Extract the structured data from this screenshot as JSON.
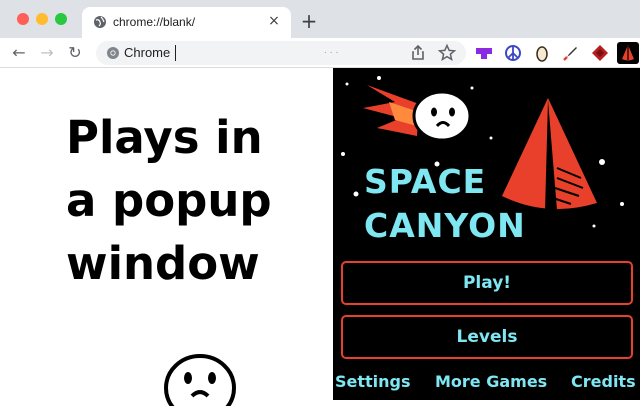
{
  "browser": {
    "tab_title": "chrome://blank/",
    "tab_close": "×",
    "new_tab": "+",
    "back": "←",
    "forward": "→",
    "reload": "↻",
    "omnibox_text": "Chrome",
    "omnibox_hint": ". . .",
    "extensions": [
      "purple-puzzle-extension",
      "peace-sign-extension",
      "egg-extension",
      "rocket-extension",
      "red-gem-extension",
      "canyon-cone-extension"
    ]
  },
  "promo": {
    "headline_lines": [
      "Plays in",
      "a popup",
      "window"
    ]
  },
  "game": {
    "title_line1": "SPACE",
    "title_line2": "CANYON",
    "play_label": "Play!",
    "levels_label": "Levels",
    "settings_label": "Settings",
    "more_games_label": "More Games",
    "credits_label": "Credits"
  },
  "colors": {
    "accent_cyan": "#7fe7f2",
    "accent_red": "#e8402a",
    "game_background": "#000000"
  }
}
